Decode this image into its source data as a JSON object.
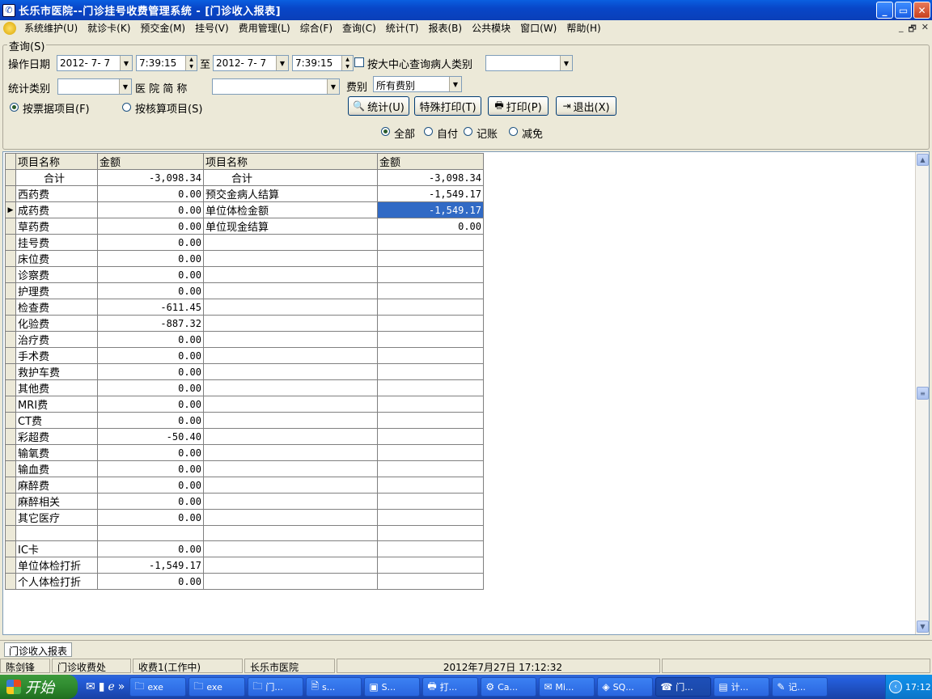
{
  "window": {
    "title": "长乐市医院--门诊挂号收费管理系统 - [门诊收入报表]",
    "buttons": {
      "minimize": "_",
      "restore": "▭",
      "close": "✕"
    }
  },
  "menubar": {
    "items": [
      "系统维护(U)",
      "就诊卡(K)",
      "预交金(M)",
      "挂号(V)",
      "费用管理(L)",
      "综合(F)",
      "查询(C)",
      "统计(T)",
      "报表(B)",
      "公共模块",
      "窗口(W)",
      "帮助(H)"
    ],
    "mdi": [
      "_",
      "🗗",
      "✕"
    ]
  },
  "query": {
    "group_title": "查询(S)",
    "op_date_label": "操作日期",
    "date_from": "2012- 7- 7",
    "time_from": "7:39:15",
    "to_label": "至",
    "date_to": "2012- 7- 7",
    "time_to": "7:39:15",
    "center_check_label": "按大中心查询病人类别",
    "patient_type_value": "",
    "stat_type_label": "统计类别",
    "stat_type_value": "",
    "hospital_abbr_label": "医 院 简 称",
    "hospital_abbr_value": "",
    "fee_type_label": "费别",
    "fee_type_value": "所有费别",
    "radio_ticket_label": "按票据项目(F)",
    "radio_account_label": "按核算项目(S)",
    "btn_stat": "统计(U)",
    "btn_special_print": "特殊打印(T)",
    "btn_print": "打印(P)",
    "btn_exit": "退出(X)",
    "pay_radios": [
      "全部",
      "自付",
      "记账",
      "减免"
    ]
  },
  "grid": {
    "headers": [
      "项目名称",
      "金额",
      "项目名称",
      "金额"
    ],
    "rows": [
      [
        "合计",
        "-3,098.34",
        "合计",
        "-3,098.34"
      ],
      [
        "西药费",
        "0.00",
        "预交金病人结算",
        "-1,549.17"
      ],
      [
        "成药费",
        "0.00",
        "单位体检金额",
        "-1,549.17"
      ],
      [
        "草药费",
        "0.00",
        "单位现金结算",
        "0.00"
      ],
      [
        "挂号费",
        "0.00",
        "",
        ""
      ],
      [
        "床位费",
        "0.00",
        "",
        ""
      ],
      [
        "诊察费",
        "0.00",
        "",
        ""
      ],
      [
        "护理费",
        "0.00",
        "",
        ""
      ],
      [
        "检查费",
        "-611.45",
        "",
        ""
      ],
      [
        "化验费",
        "-887.32",
        "",
        ""
      ],
      [
        "治疗费",
        "0.00",
        "",
        ""
      ],
      [
        "手术费",
        "0.00",
        "",
        ""
      ],
      [
        "救护车费",
        "0.00",
        "",
        ""
      ],
      [
        "其他费",
        "0.00",
        "",
        ""
      ],
      [
        "MRI费",
        "0.00",
        "",
        ""
      ],
      [
        "CT费",
        "0.00",
        "",
        ""
      ],
      [
        "彩超费",
        "-50.40",
        "",
        ""
      ],
      [
        "输氧费",
        "0.00",
        "",
        ""
      ],
      [
        "输血费",
        "0.00",
        "",
        ""
      ],
      [
        "麻醉费",
        "0.00",
        "",
        ""
      ],
      [
        "麻醉相关",
        "0.00",
        "",
        ""
      ],
      [
        "其它医疗",
        "0.00",
        "",
        ""
      ],
      [
        "",
        "",
        "",
        ""
      ],
      [
        "IC卡",
        "0.00",
        "",
        ""
      ],
      [
        "单位体检打折",
        "-1,549.17",
        "",
        ""
      ],
      [
        "个人体检打折",
        "0.00",
        "",
        ""
      ]
    ]
  },
  "tab": {
    "label": "门诊收入报表"
  },
  "status": {
    "user": "陈剑锋",
    "dept": "门诊收费处",
    "station": "收费1(工作中)",
    "hospital": "长乐市医院",
    "datetime": "2012年7月27日 17:12:32"
  },
  "taskbar": {
    "start_label": "开始",
    "tasks": [
      "exe",
      "exe",
      "门...",
      "s...",
      "S...",
      "打...",
      "Ca...",
      "Mi...",
      "SQ...",
      "门...",
      "计...",
      "记..."
    ],
    "clock": "17:12"
  }
}
